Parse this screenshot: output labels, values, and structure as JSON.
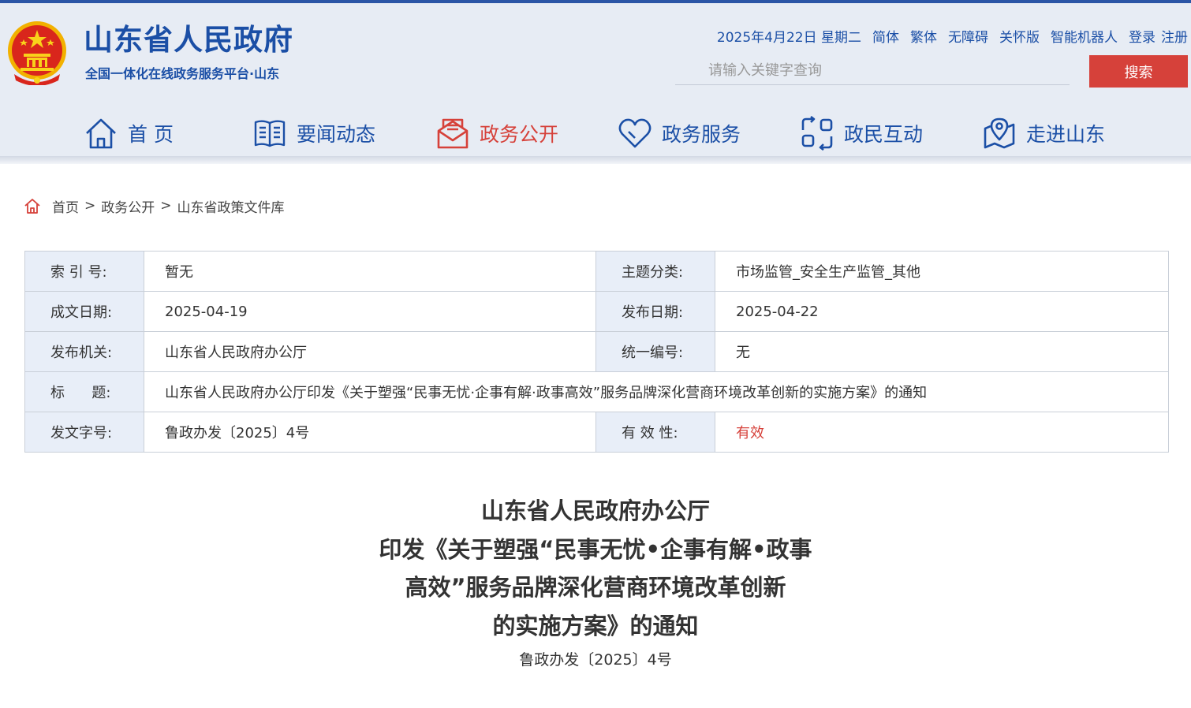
{
  "header": {
    "site_title": "山东省人民政府",
    "site_subtitle": "全国一体化在线政务服务平台·山东",
    "date": "2025年4月22日 星期二",
    "links": [
      "简体",
      "繁体",
      "无障碍",
      "关怀版",
      "智能机器人"
    ],
    "login": "登录",
    "register": "注册",
    "search_placeholder": "请输入关键字查询",
    "search_button": "搜索"
  },
  "nav": [
    {
      "label": "首 页",
      "icon": "home-icon",
      "active": false
    },
    {
      "label": "要闻动态",
      "icon": "book-icon",
      "active": false
    },
    {
      "label": "政务公开",
      "icon": "mail-icon",
      "active": true
    },
    {
      "label": "政务服务",
      "icon": "heart-icon",
      "active": false
    },
    {
      "label": "政民互动",
      "icon": "interaction-icon",
      "active": false
    },
    {
      "label": "走进山东",
      "icon": "map-pin-icon",
      "active": false
    }
  ],
  "breadcrumb": [
    "首页",
    "政务公开",
    "山东省政策文件库"
  ],
  "breadcrumb_separator": ">",
  "meta": {
    "index_label": "索 引 号:",
    "index_value": "暂无",
    "topic_label": "主题分类:",
    "topic_value": "市场监管_安全生产监管_其他",
    "written_date_label": "成文日期:",
    "written_date_value": "2025-04-19",
    "publish_date_label": "发布日期:",
    "publish_date_value": "2025-04-22",
    "issuer_label": "发布机关:",
    "issuer_value": "山东省人民政府办公厅",
    "serial_label": "统一编号:",
    "serial_value": "无",
    "title_label": "标      题:",
    "title_value": "山东省人民政府办公厅印发《关于塑强“民事无忧·企事有解·政事高效”服务品牌深化营商环境改革创新的实施方案》的通知",
    "doc_number_label": "发文字号:",
    "doc_number_value": "鲁政办发〔2025〕4号",
    "validity_label": "有 效 性:",
    "validity_value": "有效"
  },
  "document": {
    "title_lines": [
      "山东省人民政府办公厅",
      "印发《关于塑强“民事无忧•企事有解•政事",
      "高效”服务品牌深化营商环境改革创新",
      "的实施方案》的通知"
    ],
    "number": "鲁政办发〔2025〕4号"
  },
  "colors": {
    "brand_blue": "#1b4fa6",
    "accent_red": "#d6413a",
    "header_bg": "#e7ecf4",
    "table_label_bg": "#e8eef8"
  }
}
